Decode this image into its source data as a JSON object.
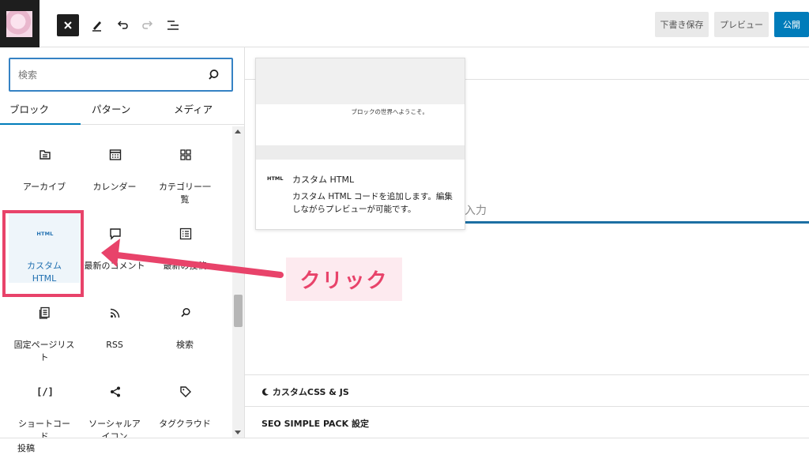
{
  "toolbar": {
    "draft_label": "下書き保存",
    "preview_label": "プレビュー",
    "publish_label": "公開"
  },
  "search": {
    "placeholder": "検索"
  },
  "tabs": [
    {
      "label": "ブロック"
    },
    {
      "label": "パターン"
    },
    {
      "label": "メディア"
    }
  ],
  "blocks": [
    {
      "label": "アーカイブ",
      "icon": "archive-icon"
    },
    {
      "label": "カレンダー",
      "icon": "calendar-icon"
    },
    {
      "label": "カテゴリー一覧",
      "icon": "categories-icon"
    },
    {
      "label": "カスタム HTML",
      "icon": "html-icon",
      "icon_text": "HTML"
    },
    {
      "label": "最新のコメント",
      "icon": "comment-icon"
    },
    {
      "label": "最新の投稿",
      "icon": "list-icon"
    },
    {
      "label": "固定ページリスト",
      "icon": "page-list-icon"
    },
    {
      "label": "RSS",
      "icon": "rss-icon"
    },
    {
      "label": "検索",
      "icon": "search-icon"
    },
    {
      "label": "ショートコード",
      "icon": "shortcode-icon",
      "icon_text": "[/]"
    },
    {
      "label": "ソーシャルアイコン",
      "icon": "share-icon"
    },
    {
      "label": "タグクラウド",
      "icon": "tag-icon"
    }
  ],
  "preview": {
    "welcome_text": "ブロックの世界へようこそ。",
    "tag": "HTML",
    "title": "カスタム HTML",
    "description": "カスタム HTML コードを追加します。編集しながらプレビューが可能です。"
  },
  "canvas": {
    "placeholder_fragment": "入力"
  },
  "annotation": {
    "click_label": "クリック",
    "color": "#e8436a"
  },
  "meta": {
    "css_js_label": "カスタムCSS & JS",
    "seo_label": "SEO SIMPLE PACK 設定"
  },
  "footer": {
    "label": "投稿"
  },
  "colors": {
    "accent": "#007cba",
    "highlight": "#e8436a"
  }
}
